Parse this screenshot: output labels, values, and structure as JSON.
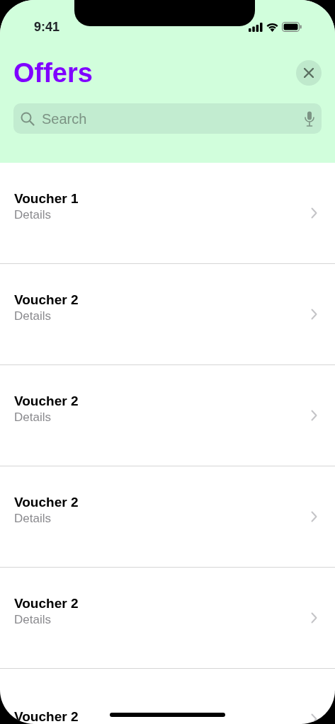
{
  "status_bar": {
    "time": "9:41"
  },
  "header": {
    "title": "Offers"
  },
  "search": {
    "placeholder": "Search"
  },
  "vouchers": [
    {
      "title": "Voucher 1",
      "details": "Details"
    },
    {
      "title": "Voucher 2",
      "details": "Details"
    },
    {
      "title": "Voucher 2",
      "details": "Details"
    },
    {
      "title": "Voucher 2",
      "details": "Details"
    },
    {
      "title": "Voucher 2",
      "details": "Details"
    },
    {
      "title": "Voucher 2"
    }
  ]
}
